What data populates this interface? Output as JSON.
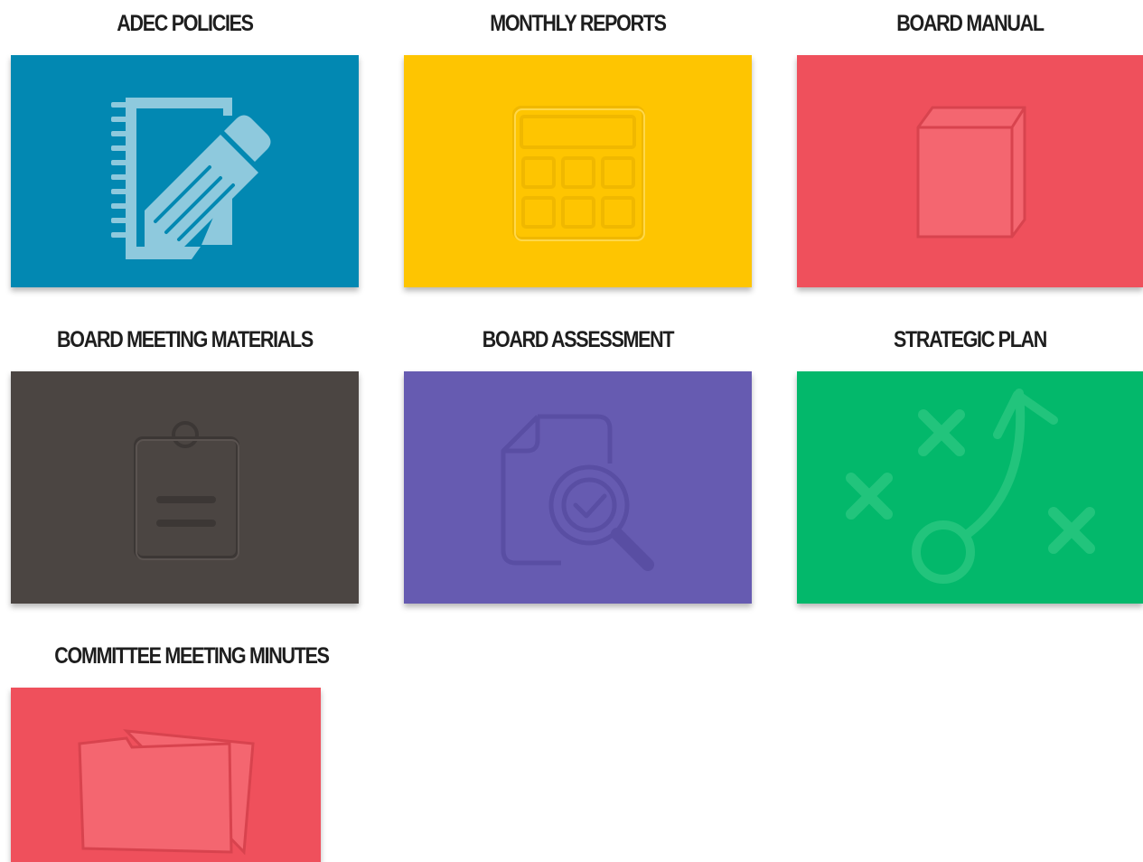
{
  "tiles": [
    {
      "title": "ADEC POLICIES",
      "icon": "notebook-pencil-icon",
      "color": "#0288b2"
    },
    {
      "title": "MONTHLY REPORTS",
      "icon": "calendar-icon",
      "color": "#fec501"
    },
    {
      "title": "BOARD MANUAL",
      "icon": "book-icon",
      "color": "#ef505c"
    },
    {
      "title": "BOARD MEETING MATERIALS",
      "icon": "clipboard-icon",
      "color": "#4b4542"
    },
    {
      "title": "BOARD ASSESSMENT",
      "icon": "document-search-icon",
      "color": "#665bb1"
    },
    {
      "title": "STRATEGIC PLAN",
      "icon": "strategy-play-icon",
      "color": "#03b86b"
    },
    {
      "title": "COMMITTEE MEETING MINUTES",
      "icon": "folder-icon",
      "color": "#ef505c"
    }
  ]
}
